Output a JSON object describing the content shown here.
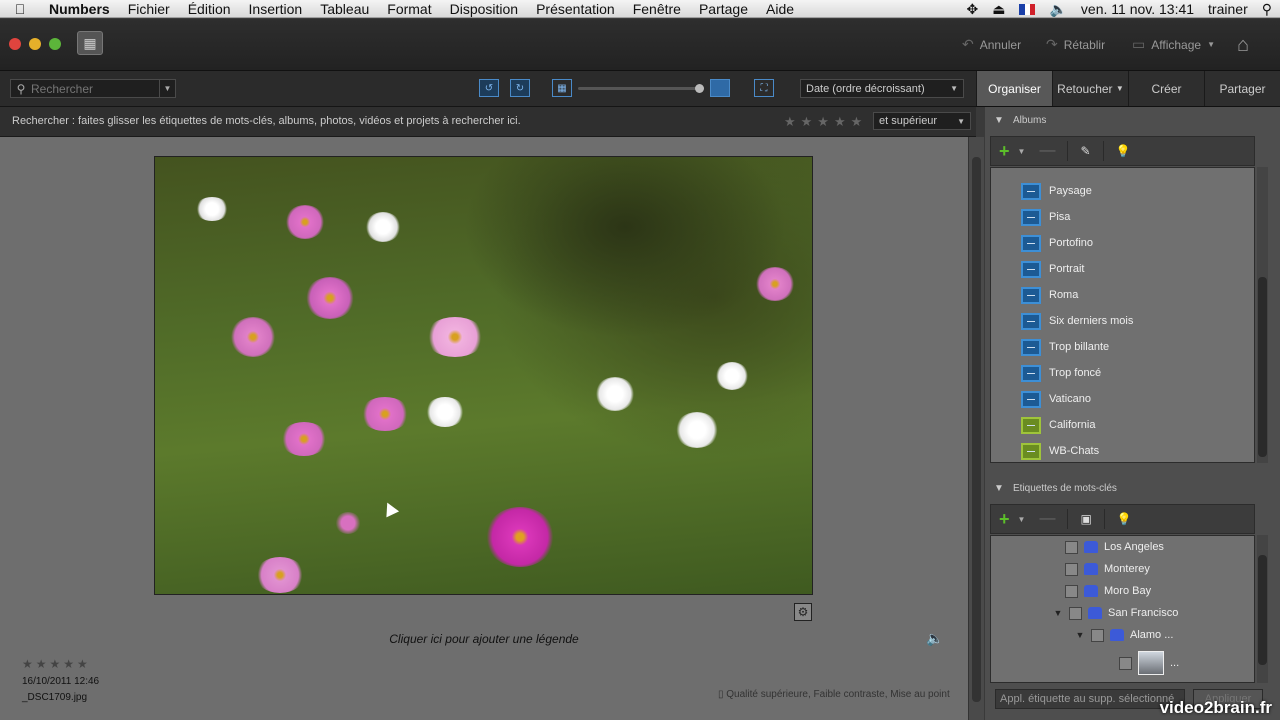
{
  "menubar": {
    "app": "Numbers",
    "items": [
      "Fichier",
      "Édition",
      "Insertion",
      "Tableau",
      "Format",
      "Disposition",
      "Présentation",
      "Fenêtre",
      "Partage",
      "Aide"
    ],
    "clock": "ven. 11 nov.  13:41",
    "user": "trainer"
  },
  "titlebar": {
    "undo": "Annuler",
    "redo": "Rétablir",
    "view": "Affichage"
  },
  "toolbar": {
    "search_placeholder": "Rechercher",
    "sort": "Date (ordre décroissant)"
  },
  "tabs": [
    "Organiser",
    "Retoucher",
    "Créer",
    "Partager"
  ],
  "hint": {
    "text": "Rechercher : faites glisser les étiquettes de mots-clés, albums, photos, vidéos et projets à rechercher ici.",
    "rating_filter": "et supérieur"
  },
  "media": {
    "caption": "Cliquer ici pour ajouter une légende",
    "date": "16/10/2011 12:46",
    "filename": "_DSC1709.jpg",
    "quality": "Qualité supérieure, Faible contraste, Mise au point",
    "stars": "★★★★★"
  },
  "albums": {
    "title": "Albums",
    "items": [
      {
        "label": "Paysage",
        "smart": false
      },
      {
        "label": "Pisa",
        "smart": false
      },
      {
        "label": "Portofino",
        "smart": false
      },
      {
        "label": "Portrait",
        "smart": false
      },
      {
        "label": "Roma",
        "smart": false
      },
      {
        "label": "Six derniers mois",
        "smart": false
      },
      {
        "label": "Trop billante",
        "smart": false
      },
      {
        "label": "Trop foncé",
        "smart": false
      },
      {
        "label": "Vaticano",
        "smart": false
      },
      {
        "label": "California",
        "smart": true
      },
      {
        "label": "WB-Chats",
        "smart": true
      }
    ]
  },
  "keywords": {
    "title": "Etiquettes de mots-clés",
    "items": [
      {
        "label": "Los Angeles",
        "indent": 0,
        "expand": false
      },
      {
        "label": "Monterey",
        "indent": 0,
        "expand": false
      },
      {
        "label": "Moro Bay",
        "indent": 0,
        "expand": false
      },
      {
        "label": "San Francisco",
        "indent": 0,
        "expand": true
      },
      {
        "label": "Alamo ...",
        "indent": 1,
        "expand": true
      }
    ],
    "thumb_label": "...",
    "apply_placeholder": "Appl. étiquette au supp. sélectionné",
    "apply_button": "Appliquer"
  },
  "watermark": "video2brain.fr"
}
